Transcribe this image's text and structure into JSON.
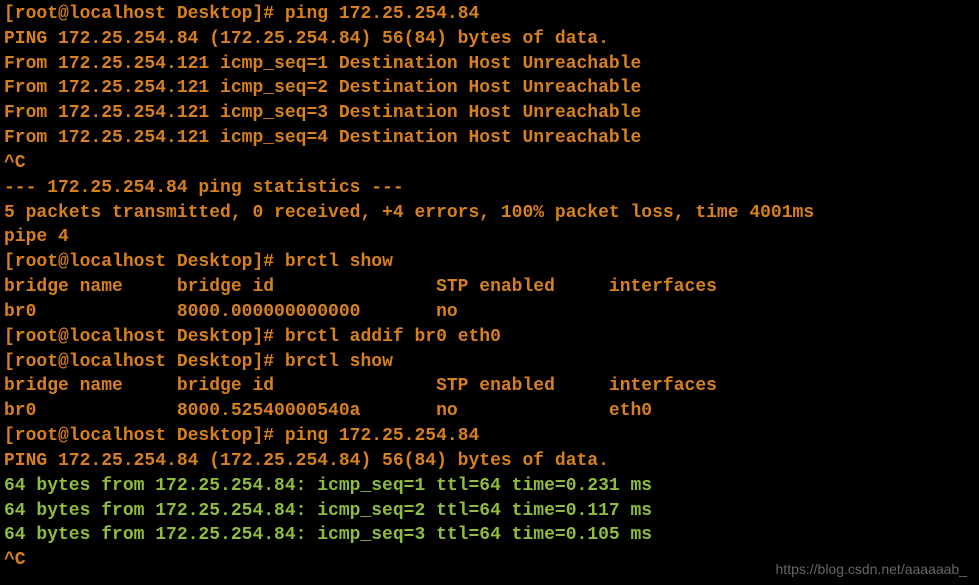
{
  "lines": [
    {
      "type": "prompt",
      "prompt": "[root@localhost Desktop]# ",
      "command": "ping 172.25.254.84"
    },
    {
      "type": "output",
      "text": "PING 172.25.254.84 (172.25.254.84) 56(84) bytes of data."
    },
    {
      "type": "output",
      "text": "From 172.25.254.121 icmp_seq=1 Destination Host Unreachable"
    },
    {
      "type": "output",
      "text": "From 172.25.254.121 icmp_seq=2 Destination Host Unreachable"
    },
    {
      "type": "output",
      "text": "From 172.25.254.121 icmp_seq=3 Destination Host Unreachable"
    },
    {
      "type": "output",
      "text": "From 172.25.254.121 icmp_seq=4 Destination Host Unreachable"
    },
    {
      "type": "output",
      "text": "^C"
    },
    {
      "type": "output",
      "text": "--- 172.25.254.84 ping statistics ---"
    },
    {
      "type": "output",
      "text": "5 packets transmitted, 0 received, +4 errors, 100% packet loss, time 4001ms"
    },
    {
      "type": "output",
      "text": "pipe 4"
    },
    {
      "type": "prompt",
      "prompt": "[root@localhost Desktop]# ",
      "command": "brctl show"
    },
    {
      "type": "output",
      "text": "bridge name     bridge id               STP enabled     interfaces"
    },
    {
      "type": "output",
      "text": "br0             8000.000000000000       no"
    },
    {
      "type": "prompt",
      "prompt": "[root@localhost Desktop]# ",
      "command": "brctl addif br0 eth0"
    },
    {
      "type": "prompt",
      "prompt": "[root@localhost Desktop]# ",
      "command": "brctl show"
    },
    {
      "type": "output",
      "text": "bridge name     bridge id               STP enabled     interfaces"
    },
    {
      "type": "output",
      "text": "br0             8000.52540000540a       no              eth0"
    },
    {
      "type": "prompt",
      "prompt": "[root@localhost Desktop]# ",
      "command": "ping 172.25.254.84"
    },
    {
      "type": "output",
      "text": "PING 172.25.254.84 (172.25.254.84) 56(84) bytes of data."
    },
    {
      "type": "reply",
      "text": "64 bytes from 172.25.254.84: icmp_seq=1 ttl=64 time=0.231 ms"
    },
    {
      "type": "reply",
      "text": "64 bytes from 172.25.254.84: icmp_seq=2 ttl=64 time=0.117 ms"
    },
    {
      "type": "reply",
      "text": "64 bytes from 172.25.254.84: icmp_seq=3 ttl=64 time=0.105 ms"
    },
    {
      "type": "output",
      "text": "^C"
    }
  ],
  "watermark": "https://blog.csdn.net/aaaaaab_"
}
